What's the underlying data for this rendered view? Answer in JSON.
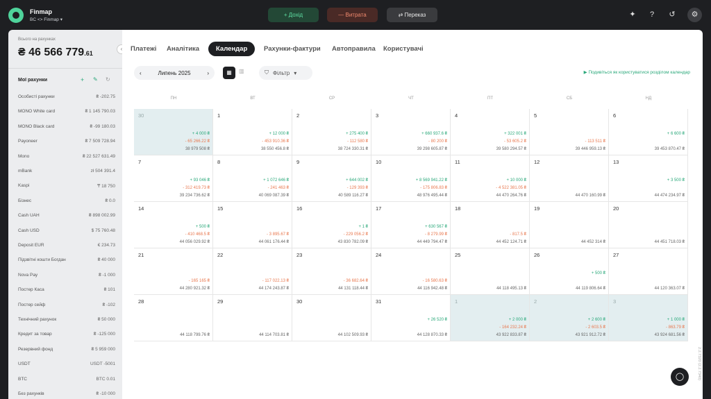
{
  "app": {
    "name": "Finmap",
    "workspace": "BC <> Finmap"
  },
  "topbar": {
    "income": "+ Дохід",
    "expense": "— Витрата",
    "transfer": "⇄ Переказ"
  },
  "sidebar": {
    "total_label": "Всього на рахунках",
    "total_main": "₴ 46 566 779",
    "total_cents": ".61",
    "accounts_title": "Мої рахунки",
    "accounts": [
      {
        "name": "Особисті рахунки",
        "value": "₴ -202.75"
      },
      {
        "name": "MONO White card",
        "value": "₴ 1 145 790.03"
      },
      {
        "name": "MONO Black card",
        "value": "₴ -99 180.03"
      },
      {
        "name": "Payoneer",
        "value": "₴ 7 509 728.94"
      },
      {
        "name": "Mono",
        "value": "₴ 22 527 631.49"
      },
      {
        "name": "mBank",
        "value": "zł 504 391.4"
      },
      {
        "name": "Kaspi",
        "value": "₸ 18 750"
      },
      {
        "name": "Бізнес",
        "value": "₴ 0.0"
      },
      {
        "name": "Cash UAH",
        "value": "₴ 898 002.99"
      },
      {
        "name": "Cash USD",
        "value": "$ 75 760.48"
      },
      {
        "name": "Deposit EUR",
        "value": "€ 234.73"
      },
      {
        "name": "Підзвітні кошти Богдан",
        "value": "₴ 40 000"
      },
      {
        "name": "Nova Pay",
        "value": "₴ -1 000"
      },
      {
        "name": "Постер Каса",
        "value": "₴ 101"
      },
      {
        "name": "Постер сейф",
        "value": "₴ -102"
      },
      {
        "name": "Технічний рахунок",
        "value": "₴ 50 000"
      },
      {
        "name": "Кредит за товар",
        "value": "₴ -125 000"
      },
      {
        "name": "Резервний фонд",
        "value": "₴ 5 959 000"
      },
      {
        "name": "USDT",
        "value": "USDT -5001"
      },
      {
        "name": "BTC",
        "value": "BTC 0.01"
      },
      {
        "name": "Без рахунків",
        "value": "₴ -10 000"
      }
    ]
  },
  "tabs": [
    "Платежі",
    "Аналітика",
    "Календар",
    "Рахунки-фактури",
    "Автоправила",
    "Користувачі"
  ],
  "toolbar": {
    "month": "Липень 2025",
    "filter": "Фільтр",
    "help": "Подивіться як користуватися розділом календар"
  },
  "weekdays": [
    "ПН",
    "ВТ",
    "СР",
    "ЧТ",
    "ПТ",
    "СБ",
    "НД"
  ],
  "calendar": [
    [
      {
        "d": "30",
        "dim": true,
        "i": "+ 4 000 ₴",
        "e": "- 65 266.22 ₴",
        "b": "38 979 508 ₴"
      },
      {
        "d": "1",
        "i": "+ 12 000 ₴",
        "e": "- 453 910.36 ₴",
        "b": "38 550 456.8 ₴"
      },
      {
        "d": "2",
        "i": "+ 275 400 ₴",
        "e": "- 112 580 ₴",
        "b": "38 724 330.31 ₴"
      },
      {
        "d": "3",
        "i": "+ 660 937.6 ₴",
        "e": "- 80 200 ₴",
        "b": "39 298 605.87 ₴"
      },
      {
        "d": "4",
        "i": "+ 322 001 ₴",
        "e": "- 53 605.2 ₴",
        "b": "39 580 294.57 ₴"
      },
      {
        "d": "5",
        "i": "",
        "e": "- 113 511 ₴",
        "b": "39 446 959.13 ₴"
      },
      {
        "d": "6",
        "i": "+ 6 600 ₴",
        "e": "",
        "b": "39 453 870.47 ₴"
      }
    ],
    [
      {
        "d": "7",
        "i": "+ 93 046 ₴",
        "e": "- 312 419.73 ₴",
        "b": "39 234 736.62 ₴"
      },
      {
        "d": "8",
        "i": "+ 1 072 646 ₴",
        "e": "- 241 463 ₴",
        "b": "40 069 087.39 ₴"
      },
      {
        "d": "9",
        "i": "+ 644 002 ₴",
        "e": "- 129 393 ₴",
        "b": "40 589 116.27 ₴"
      },
      {
        "d": "10",
        "i": "+ 8 569 941.22 ₴",
        "e": "- 175 806.83 ₴",
        "b": "48 976 495.44 ₴"
      },
      {
        "d": "11",
        "i": "+ 10 000 ₴",
        "e": "- 4 522 381.05 ₴",
        "b": "44 470 264.76 ₴"
      },
      {
        "d": "12",
        "i": "",
        "e": "",
        "b": "44 470 160.99 ₴"
      },
      {
        "d": "13",
        "i": "+ 3 500 ₴",
        "e": "",
        "b": "44 474 234.97 ₴"
      }
    ],
    [
      {
        "d": "14",
        "i": "+ 500 ₴",
        "e": "- 410 468.5 ₴",
        "b": "44 056 029.92 ₴"
      },
      {
        "d": "15",
        "i": "",
        "e": "- 3 895.67 ₴",
        "b": "44 061 176.44 ₴"
      },
      {
        "d": "16",
        "i": "+ 1 ₴",
        "e": "- 229 056.2 ₴",
        "b": "43 830 782.09 ₴"
      },
      {
        "d": "17",
        "i": "+ 630 567 ₴",
        "e": "- 8 279.99 ₴",
        "b": "44 449 794.47 ₴"
      },
      {
        "d": "18",
        "i": "",
        "e": "- 817.5 ₴",
        "b": "44 452 124.71 ₴"
      },
      {
        "d": "19",
        "i": "",
        "e": "",
        "b": "44 452 314 ₴"
      },
      {
        "d": "20",
        "i": "",
        "e": "",
        "b": "44 451 718.03 ₴"
      }
    ],
    [
      {
        "d": "21",
        "i": "",
        "e": "- 165 165 ₴",
        "b": "44 280 921.32 ₴"
      },
      {
        "d": "22",
        "i": "",
        "e": "- 117 022.13 ₴",
        "b": "44 174 243.87 ₴"
      },
      {
        "d": "23",
        "i": "",
        "e": "- 36 682.64 ₴",
        "b": "44 131 118.44 ₴"
      },
      {
        "d": "24",
        "i": "",
        "e": "- 16 580.63 ₴",
        "b": "44 116 942.48 ₴"
      },
      {
        "d": "25",
        "i": "",
        "e": "",
        "b": "44 118 495.13 ₴"
      },
      {
        "d": "26",
        "i": "+ 500 ₴",
        "e": "",
        "b": "44 119 806.64 ₴"
      },
      {
        "d": "27",
        "i": "",
        "e": "",
        "b": "44 120 363.07 ₴"
      }
    ],
    [
      {
        "d": "28",
        "i": "",
        "e": "",
        "b": "44 118 799.76 ₴"
      },
      {
        "d": "29",
        "i": "",
        "e": "",
        "b": "44 114 703.81 ₴"
      },
      {
        "d": "30",
        "i": "",
        "e": "",
        "b": "44 102 509.93 ₴"
      },
      {
        "d": "31",
        "i": "+ 26 520 ₴",
        "e": "",
        "b": "44 128 870.33 ₴"
      },
      {
        "d": "1",
        "dim": true,
        "i": "+ 2 000 ₴",
        "e": "- 164 232.24 ₴",
        "b": "43 922 833.87 ₴"
      },
      {
        "d": "2",
        "dim": true,
        "i": "+ 2 600 ₴",
        "e": "- 2 603.5 ₴",
        "b": "43 921 912.72 ₴"
      },
      {
        "d": "3",
        "dim": true,
        "i": "+ 1 000 ₴",
        "e": "- 863.79 ₴",
        "b": "43 924 681.56 ₴"
      }
    ]
  ],
  "version": "2.2.7320 (2.2.7340)"
}
